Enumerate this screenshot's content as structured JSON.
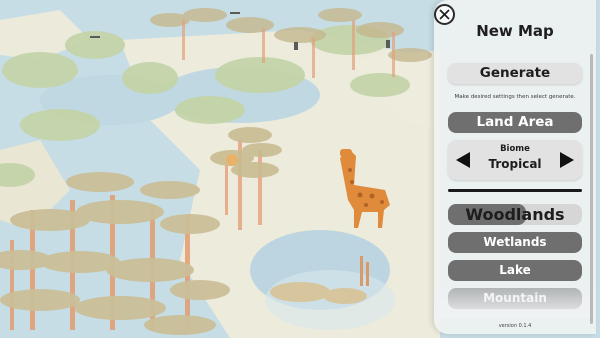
{
  "panel": {
    "title": "New Map",
    "generate_label": "Generate",
    "hint": "Make desired settings then select generate.",
    "land_area_label": "Land Area",
    "biome": {
      "label": "Biome",
      "value": "Tropical"
    },
    "options": [
      "Woodlands",
      "Wetlands",
      "Lake",
      "Mountain"
    ],
    "version": "version 0.1.4"
  },
  "colors": {
    "water": "#c9dfe7",
    "sand": "#ece9d8",
    "lily": "#c8d7b3",
    "giraffe": "#e08a3c",
    "panel": "#f0f3f3",
    "button_dark": "#6f6f6f",
    "button_light": "#e2e2e2"
  }
}
